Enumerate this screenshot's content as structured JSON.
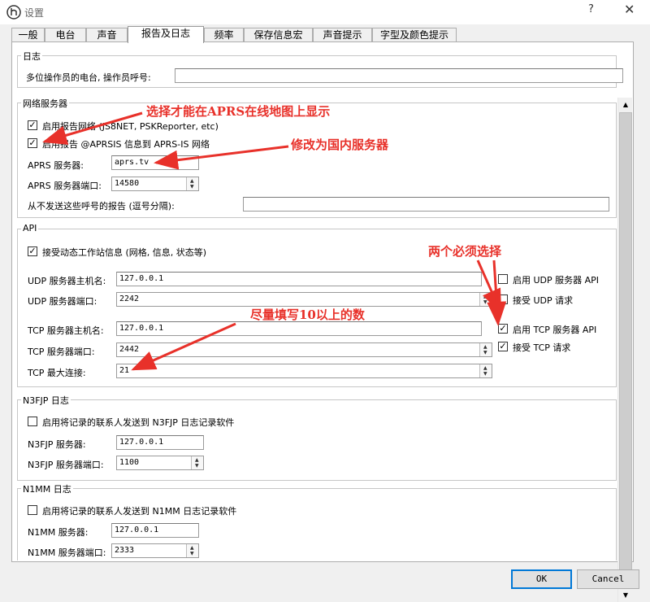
{
  "window": {
    "title": "设置",
    "help": "?",
    "close": "✕"
  },
  "tabs": [
    {
      "label": "一般"
    },
    {
      "label": "电台"
    },
    {
      "label": "声音"
    },
    {
      "label": "报告及日志",
      "active": true
    },
    {
      "label": "频率"
    },
    {
      "label": "保存信息宏"
    },
    {
      "label": "声音提示"
    },
    {
      "label": "字型及颜色提示"
    }
  ],
  "log": {
    "title": "日志",
    "operator_label": "多位操作员的电台, 操作员呼号:",
    "operator_value": ""
  },
  "network": {
    "title": "网络服务器",
    "enable_report_label": "启用报告网络 (JS8NET, PSKReporter, etc)",
    "enable_report_checked": true,
    "enable_aprsis_label": "启用报告 @APRSIS 信息到 APRS-IS 网络",
    "enable_aprsis_checked": true,
    "aprs_server_label": "APRS 服务器:",
    "aprs_server_value": "aprs.tv",
    "aprs_port_label": "APRS 服务器端口:",
    "aprs_port_value": "14580",
    "no_report_label": "从不发送这些呼号的报告 (逗号分隔):",
    "no_report_value": ""
  },
  "api": {
    "title": "API",
    "accept_label": "接受动态工作站信息 (网格, 信息, 状态等)",
    "accept_checked": true,
    "udp_host_label": "UDP 服务器主机名:",
    "udp_host_value": "127.0.0.1",
    "udp_port_label": "UDP 服务器端口:",
    "udp_port_value": "2242",
    "tcp_host_label": "TCP 服务器主机名:",
    "tcp_host_value": "127.0.0.1",
    "tcp_port_label": "TCP 服务器端口:",
    "tcp_port_value": "2442",
    "tcp_max_label": "TCP 最大连接:",
    "tcp_max_value": "21",
    "enable_udp_label": "启用 UDP 服务器 API",
    "enable_udp_checked": false,
    "accept_udp_label": "接受 UDP 请求",
    "accept_udp_checked": false,
    "enable_tcp_label": "启用 TCP 服务器 API",
    "enable_tcp_checked": true,
    "accept_tcp_label": "接受 TCP 请求",
    "accept_tcp_checked": true
  },
  "n3fjp": {
    "title": "N3FJP 日志",
    "send_label": "启用将记录的联系人发送到 N3FJP 日志记录软件",
    "send_checked": false,
    "server_label": "N3FJP 服务器:",
    "server_value": "127.0.0.1",
    "port_label": "N3FJP 服务器端口:",
    "port_value": "1100"
  },
  "n1mm": {
    "title": "N1MM 日志",
    "send_label": "启用将记录的联系人发送到 N1MM 日志记录软件",
    "send_checked": false,
    "server_label": "N1MM 服务器:",
    "server_value": "127.0.0.1",
    "port_label": "N1MM 服务器端口:",
    "port_value": "2333"
  },
  "buttons": {
    "ok": "OK",
    "cancel": "Cancel"
  },
  "annotations": {
    "aprs_map": "选择才能在APRS在线地图上显示",
    "domestic_server": "修改为国内服务器",
    "must_select": "两个必须选择",
    "over_ten": "尽量填写10以上的数"
  },
  "colors": {
    "annotation": "#e8312a",
    "ok_focus": "#0078d7"
  },
  "icons": {
    "app": "app-logo-icon",
    "check": "checkmark-icon",
    "spin_up": "up-arrow-icon",
    "spin_down": "down-arrow-icon"
  }
}
